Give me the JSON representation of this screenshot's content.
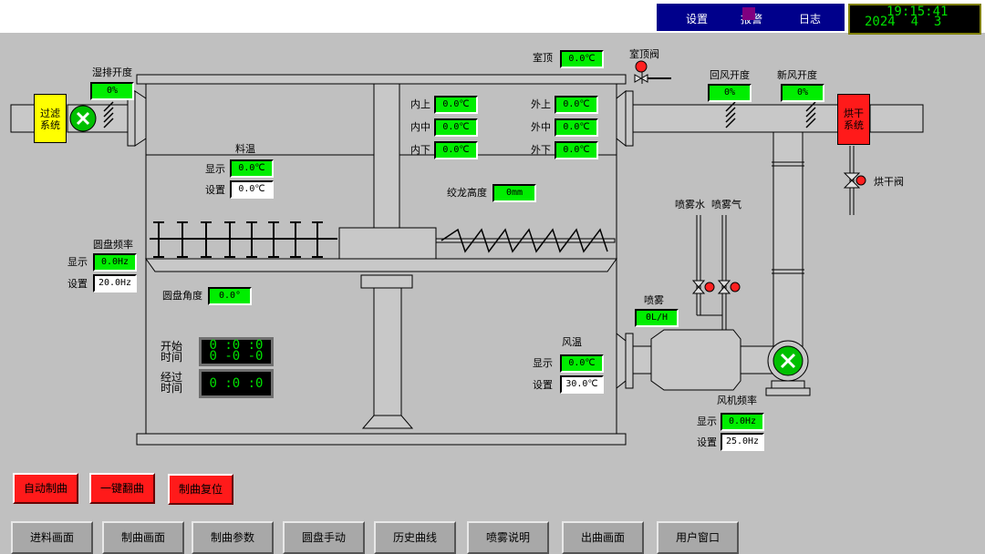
{
  "header": {
    "menu_items": [
      "设置",
      "报警",
      "日志"
    ],
    "clock_time": "19:15:41",
    "clock_date": "2024  4  3"
  },
  "left_system": {
    "label": "过滤\n系统"
  },
  "right_system": {
    "label": "烘干\n系统"
  },
  "exhaust": {
    "label": "湿排开度",
    "value": "0%"
  },
  "room_top": {
    "label": "室顶",
    "value": "0.0℃",
    "valve_label": "室顶阀"
  },
  "return_air": {
    "label": "回风开度",
    "value": "0%"
  },
  "fresh_air": {
    "label": "新风开度",
    "value": "0%"
  },
  "inner_temps": [
    {
      "label": "内上",
      "value": "0.0℃"
    },
    {
      "label": "内中",
      "value": "0.0℃"
    },
    {
      "label": "内下",
      "value": "0.0℃"
    }
  ],
  "outer_temps": [
    {
      "label": "外上",
      "value": "0.0℃"
    },
    {
      "label": "外中",
      "value": "0.0℃"
    },
    {
      "label": "外下",
      "value": "0.0℃"
    }
  ],
  "material_temp": {
    "title": "料温",
    "display_label": "显示",
    "display_value": "0.0℃",
    "set_label": "设置",
    "set_value": "0.0℃"
  },
  "auger_height": {
    "label": "绞龙高度",
    "value": "0mm"
  },
  "drying_valve": {
    "label": "烘干阀"
  },
  "spray_water": {
    "label": "喷雾水"
  },
  "spray_gas": {
    "label": "喷雾气"
  },
  "disc_freq": {
    "title": "圆盘频率",
    "display_label": "显示",
    "display_value": "0.0Hz",
    "set_label": "设置",
    "set_value": "20.0Hz"
  },
  "disc_angle": {
    "label": "圆盘角度",
    "value": "0.0°"
  },
  "spray": {
    "label": "喷雾",
    "value": "0L/H"
  },
  "start_time": {
    "label": "开始\n时间",
    "value_top": "0 :0 :0",
    "value_bottom": "0 -0 -0"
  },
  "elapsed_time": {
    "label": "经过\n时间",
    "value": "0 :0 :0"
  },
  "wind_temp": {
    "title": "风温",
    "display_label": "显示",
    "display_value": "0.0℃",
    "set_label": "设置",
    "set_value": "30.0℃"
  },
  "fan_freq": {
    "title": "风机频率",
    "display_label": "显示",
    "display_value": "0.0Hz",
    "set_label": "设置",
    "set_value": "25.0Hz"
  },
  "controls": {
    "auto": "自动制曲",
    "one_key": "一键翻曲",
    "reset": "制曲复位"
  },
  "nav": [
    "进料画面",
    "制曲画面",
    "制曲参数",
    "圆盘手动",
    "历史曲线",
    "喷雾说明",
    "出曲画面",
    "用户窗口"
  ],
  "colors": {
    "background": "#c0c0c0",
    "value_green": "#00ee00",
    "alarm_red": "#ff1a1a",
    "filter_yellow": "#ffff00",
    "header_navy": "#000080"
  }
}
